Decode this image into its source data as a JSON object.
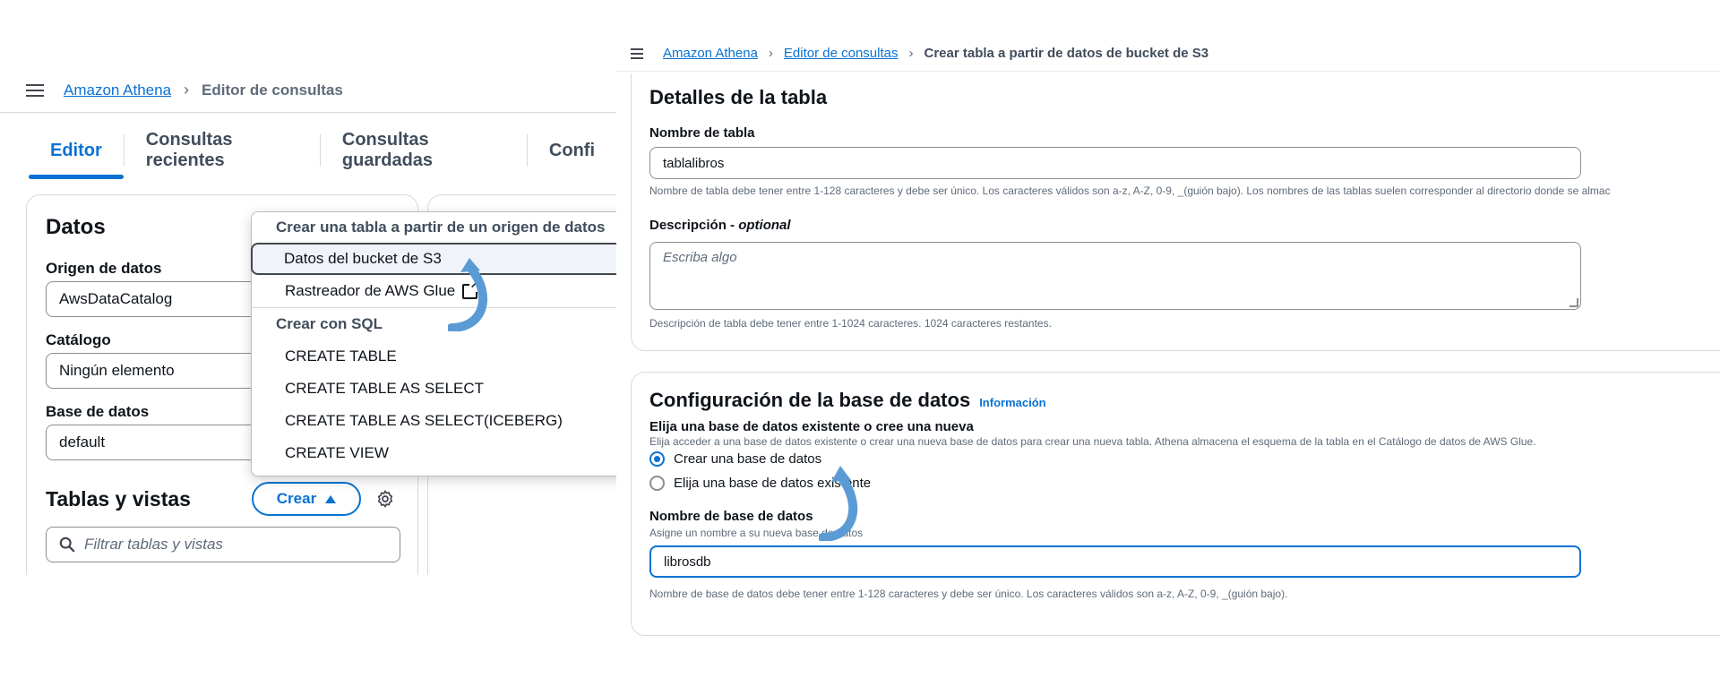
{
  "left": {
    "breadcrumb": {
      "root": "Amazon Athena",
      "current": "Editor de consultas"
    },
    "tabs": [
      "Editor",
      "Consultas recientes",
      "Consultas guardadas",
      "Confi"
    ],
    "data_panel": {
      "title": "Datos",
      "source_label": "Origen de datos",
      "source_value": "AwsDataCatalog",
      "catalog_label": "Catálogo",
      "catalog_value": "Ningún elemento",
      "database_label": "Base de datos",
      "database_value": "default",
      "tables_title": "Tablas y vistas",
      "create_button": "Crear",
      "filter_placeholder": "Filtrar tablas y vistas"
    },
    "dropdown": {
      "group1": "Crear una tabla a partir de un origen de datos",
      "item_s3": "Datos del bucket de S3",
      "item_glue": "Rastreador de AWS Glue",
      "group2": "Crear con SQL",
      "sql_items": [
        "CREATE TABLE",
        "CREATE TABLE AS SELECT",
        "CREATE TABLE AS SELECT(ICEBERG)",
        "CREATE VIEW"
      ]
    }
  },
  "right": {
    "breadcrumb": {
      "root": "Amazon Athena",
      "middle": "Editor de consultas",
      "current": "Crear tabla a partir de datos de bucket de S3"
    },
    "table_details": {
      "title": "Detalles de la tabla",
      "name_label": "Nombre de tabla",
      "name_value": "tablalibros",
      "name_hint": "Nombre de tabla debe tener entre 1-128 caracteres y debe ser único. Los caracteres válidos son a-z, A-Z, 0-9, _(guión bajo). Los nombres de las tablas suelen corresponder al directorio donde se almac",
      "desc_label": "Descripción",
      "desc_optional": "optional",
      "desc_placeholder": "Escriba algo",
      "desc_hint": "Descripción de tabla debe tener entre 1-1024 caracteres. 1024 caracteres restantes."
    },
    "db_config": {
      "title": "Configuración de la base de datos",
      "info": "Información",
      "choose_label": "Elija una base de datos existente o cree una nueva",
      "choose_hint": "Elija acceder a una base de datos existente o crear una nueva base de datos para crear una nueva tabla. Athena almacena el esquema de la tabla en el Catálogo de datos de AWS Glue.",
      "option_create": "Crear una base de datos",
      "option_existing": "Elija una base de datos existente",
      "dbname_label": "Nombre de base de datos",
      "dbname_sub": "Asigne un nombre a su nueva base de datos",
      "dbname_value": "librosdb",
      "dbname_hint": "Nombre de base de datos debe tener entre 1-128 caracteres y debe ser único. Los caracteres válidos son a-z, A-Z, 0-9, _(guión bajo)."
    }
  },
  "colors": {
    "accent": "#0972d3",
    "arrow": "#5b9bd5"
  }
}
